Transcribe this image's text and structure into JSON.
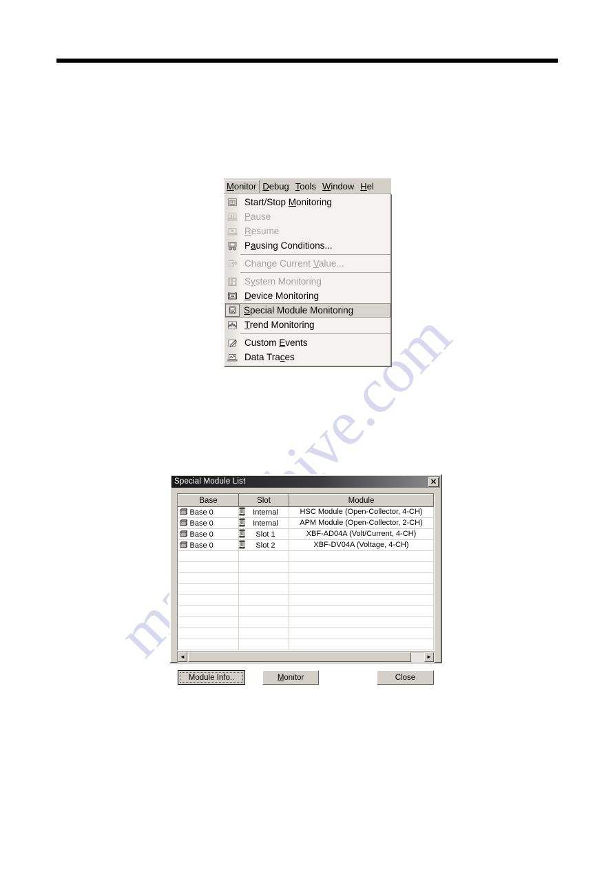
{
  "page": {
    "watermark": "manualshive.com"
  },
  "menu": {
    "menubar": [
      {
        "label": "Monitor",
        "accel": "M",
        "open": true
      },
      {
        "label": "Debug",
        "accel": "D",
        "open": false
      },
      {
        "label": "Tools",
        "accel": "T",
        "open": false
      },
      {
        "label": "Window",
        "accel": "W",
        "open": false
      },
      {
        "label": "Hel",
        "accel": "H",
        "open": false
      }
    ],
    "items": [
      {
        "label": "Start/Stop Monitoring",
        "icon": "monitor-screen-icon",
        "state": "enabled",
        "accel": "M"
      },
      {
        "label": "Pause",
        "icon": "pause-monitor-icon",
        "state": "disabled",
        "accel": "P"
      },
      {
        "label": "Resume",
        "icon": "resume-monitor-icon",
        "state": "disabled",
        "accel": "R"
      },
      {
        "label": "Pausing Conditions...",
        "icon": "pausing-conditions-icon",
        "state": "enabled",
        "accel": "a"
      },
      {
        "separator": true
      },
      {
        "label": "Change Current Value...",
        "icon": "change-value-icon",
        "state": "disabled",
        "accel": "V"
      },
      {
        "separator": true
      },
      {
        "label": "System Monitoring",
        "icon": "system-monitoring-icon",
        "state": "disabled",
        "accel": "y"
      },
      {
        "label": "Device Monitoring",
        "icon": "device-monitoring-icon",
        "state": "enabled",
        "accel": "D"
      },
      {
        "label": "Special Module Monitoring",
        "icon": "special-module-icon",
        "state": "selected",
        "accel": "S"
      },
      {
        "label": "Trend Monitoring",
        "icon": "trend-monitoring-icon",
        "state": "enabled",
        "accel": "T"
      },
      {
        "separator": true
      },
      {
        "label": "Custom Events",
        "icon": "custom-events-icon",
        "state": "enabled",
        "accel": "E"
      },
      {
        "label": "Data Traces",
        "icon": "data-traces-icon",
        "state": "enabled",
        "accel": "c"
      }
    ]
  },
  "dialog": {
    "title": "Special Module List",
    "close_label": "✕",
    "columns": [
      "Base",
      "Slot",
      "Module"
    ],
    "rows": [
      {
        "base": "Base 0",
        "slot": "Internal",
        "module": "HSC Module (Open-Collector, 4-CH)"
      },
      {
        "base": "Base 0",
        "slot": "Internal",
        "module": "APM Module (Open-Collector, 2-CH)"
      },
      {
        "base": "Base 0",
        "slot": "Slot 1",
        "module": "XBF-AD04A (Volt/Current, 4-CH)"
      },
      {
        "base": "Base 0",
        "slot": "Slot 2",
        "module": "XBF-DV04A (Voltage, 4-CH)"
      }
    ],
    "empty_row_count": 9,
    "scrollbar": {
      "left_arrow": "◄",
      "right_arrow": "►"
    },
    "buttons": {
      "module_info": "Module Info..",
      "monitor": "Monitor",
      "monitor_accel": "M",
      "close": "Close"
    }
  }
}
